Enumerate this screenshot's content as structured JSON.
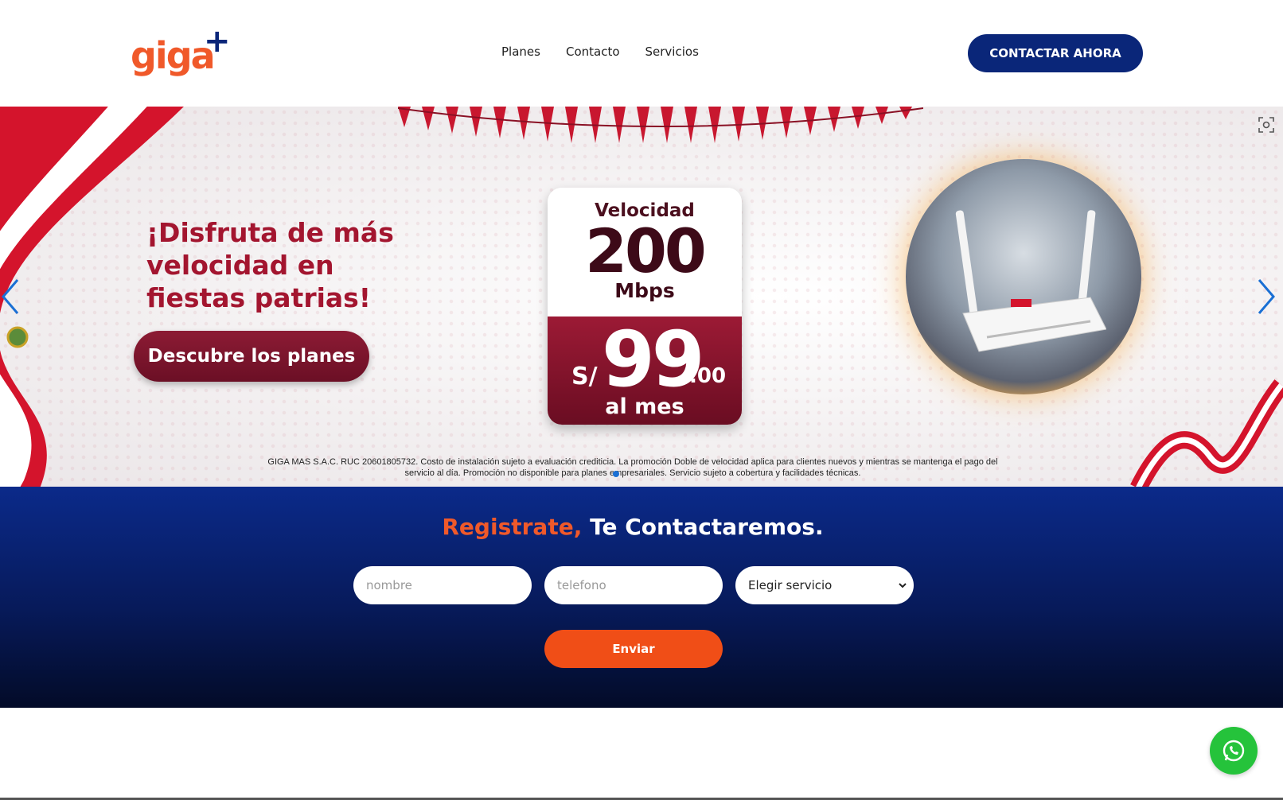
{
  "header": {
    "logo_text": "giga",
    "logo_plus": "+",
    "nav": [
      {
        "label": "Planes"
      },
      {
        "label": "Contacto"
      },
      {
        "label": "Servicios"
      }
    ],
    "cta_label": "CONTACTAR AHORA"
  },
  "hero": {
    "title": "¡Disfruta de más velocidad en fiestas patrias!",
    "button_label": "Descubre los planes",
    "card": {
      "label": "Velocidad",
      "speed": "200",
      "unit": "Mbps",
      "currency": "S/",
      "price": "99",
      "cents": ".00",
      "period": "al mes"
    },
    "disclaimer": "GIGA MAS S.A.C. RUC 20601805732.  Costo de instalación sujeto a evaluación crediticia. La promoción Doble de velocidad aplica para clientes nuevos y mientras se mantenga el pago del servicio al día. Promoción no disponible para planes empresariales. Servicio sujeto a cobertura y facilidades técnicas.",
    "icons": {
      "prev": "chevron-left-icon",
      "next": "chevron-right-icon",
      "zoom": "zoom-focus-icon"
    }
  },
  "register": {
    "title_accent": "Registrate,",
    "title_rest": " Te Contactaremos.",
    "name_placeholder": "nombre",
    "phone_placeholder": "telefono",
    "service_selected": "Elegir servicio",
    "submit_label": "Enviar"
  },
  "whatsapp": {
    "icon": "whatsapp-icon"
  },
  "colors": {
    "brand_orange": "#f0592a",
    "brand_navy": "#0a2679",
    "hero_red": "#a3152f",
    "send_orange": "#f04e17",
    "whatsapp_green": "#25c33b"
  }
}
